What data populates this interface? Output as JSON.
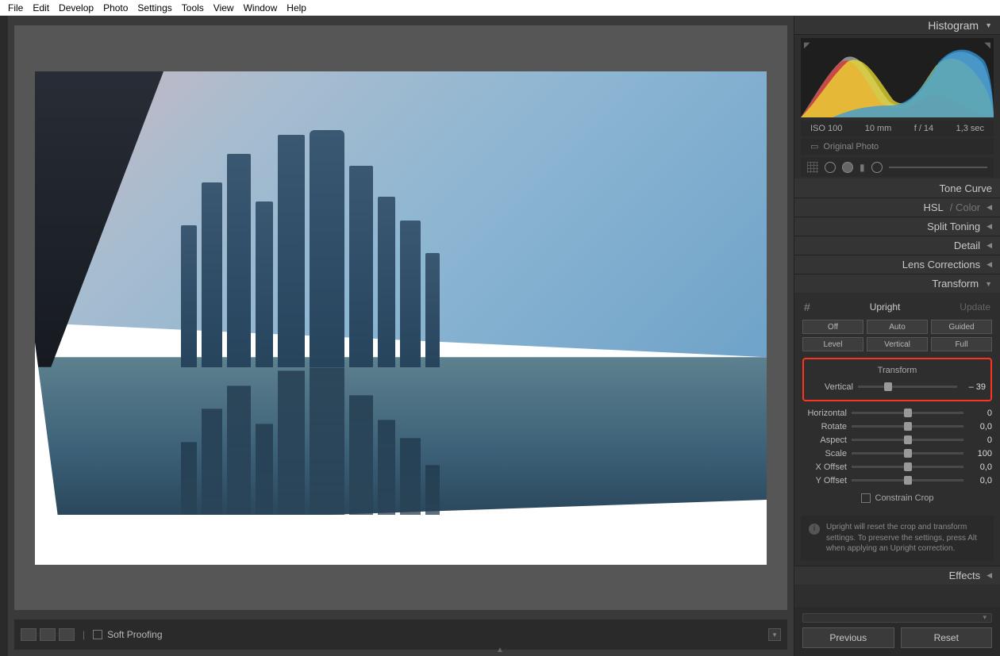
{
  "menu": [
    "File",
    "Edit",
    "Develop",
    "Photo",
    "Settings",
    "Tools",
    "View",
    "Window",
    "Help"
  ],
  "histogram": {
    "title": "Histogram",
    "meta": {
      "iso": "ISO 100",
      "focal": "10 mm",
      "aperture": "f / 14",
      "shutter": "1,3 sec"
    },
    "original_label": "Original Photo"
  },
  "sections": {
    "tone_curve": "Tone Curve",
    "hsl": "HSL",
    "color": " / Color",
    "split_toning": "Split Toning",
    "detail": "Detail",
    "lens_corrections": "Lens Corrections",
    "transform": "Transform",
    "effects": "Effects"
  },
  "transform": {
    "upright": {
      "label": "Upright",
      "update": "Update"
    },
    "buttons": {
      "off": "Off",
      "auto": "Auto",
      "guided": "Guided",
      "level": "Level",
      "vertical": "Vertical",
      "full": "Full"
    },
    "sub_header": "Transform",
    "sliders": {
      "vertical": {
        "label": "Vertical",
        "value": "– 39",
        "pos": 30
      },
      "horizontal": {
        "label": "Horizontal",
        "value": "0",
        "pos": 50
      },
      "rotate": {
        "label": "Rotate",
        "value": "0,0",
        "pos": 50
      },
      "aspect": {
        "label": "Aspect",
        "value": "0",
        "pos": 50
      },
      "scale": {
        "label": "Scale",
        "value": "100",
        "pos": 50
      },
      "xoffset": {
        "label": "X Offset",
        "value": "0,0",
        "pos": 50
      },
      "yoffset": {
        "label": "Y Offset",
        "value": "0,0",
        "pos": 50
      }
    },
    "constrain": "Constrain Crop",
    "info": "Upright will reset the crop and transform settings. To preserve the settings, press Alt when applying an Upright correction."
  },
  "footer": {
    "previous": "Previous",
    "reset": "Reset"
  },
  "bottom_bar": {
    "soft_proofing": "Soft Proofing"
  }
}
